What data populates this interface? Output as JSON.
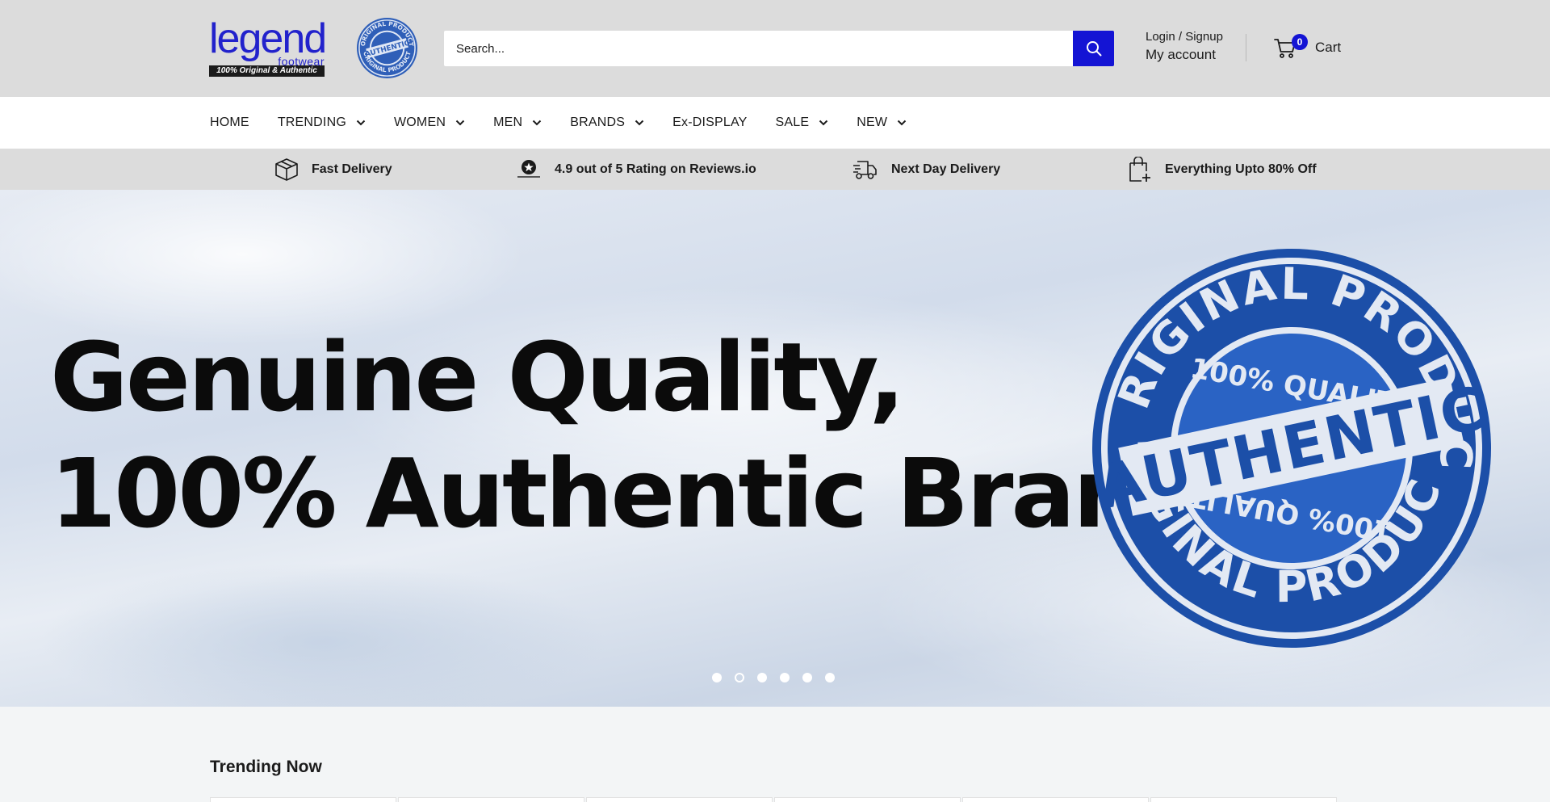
{
  "header": {
    "logo": {
      "word": "legend",
      "sub": "footwear",
      "tagline": "100% Original & Authentic"
    },
    "seal_text": {
      "top": "ORIGINAL PRODUCT",
      "middle": "AUTHENTIC",
      "bottom": "ORIGINAL PRODUCT"
    },
    "search": {
      "placeholder": "Search..."
    },
    "account": {
      "login_label": "Login / Signup",
      "my_account_label": "My account"
    },
    "cart": {
      "count": "0",
      "label": "Cart"
    }
  },
  "nav": {
    "items": [
      {
        "label": "HOME",
        "has_dropdown": false
      },
      {
        "label": "TRENDING",
        "has_dropdown": true
      },
      {
        "label": "WOMEN",
        "has_dropdown": true
      },
      {
        "label": "MEN",
        "has_dropdown": true
      },
      {
        "label": "BRANDS",
        "has_dropdown": true
      },
      {
        "label": "Ex-DISPLAY",
        "has_dropdown": false
      },
      {
        "label": "SALE",
        "has_dropdown": true
      },
      {
        "label": "NEW",
        "has_dropdown": true
      }
    ]
  },
  "features": [
    {
      "icon": "box-icon",
      "label": "Fast Delivery"
    },
    {
      "icon": "reviews-io-icon",
      "label": "4.9 out of 5 Rating on Reviews.io"
    },
    {
      "icon": "delivery-truck-icon",
      "label": "Next Day Delivery"
    },
    {
      "icon": "shopping-bag-icon",
      "label": "Everything Upto 80% Off"
    }
  ],
  "hero": {
    "line1": "Genuine Quality,",
    "line2": "100% Authentic Brands",
    "stamp": {
      "ring_top": "ORIGINAL PRODUCT",
      "ring_bottom": "ORIGINAL PRODUCT",
      "quality": "100% QUALITY",
      "center": "AUTHENTIC"
    },
    "slides": 6,
    "active_slide": 2
  },
  "trending": {
    "title": "Trending Now"
  },
  "colors": {
    "accent": "#1414d4",
    "header_bg": "#dcdcdc",
    "stamp_blue": "#1c4fa8"
  }
}
